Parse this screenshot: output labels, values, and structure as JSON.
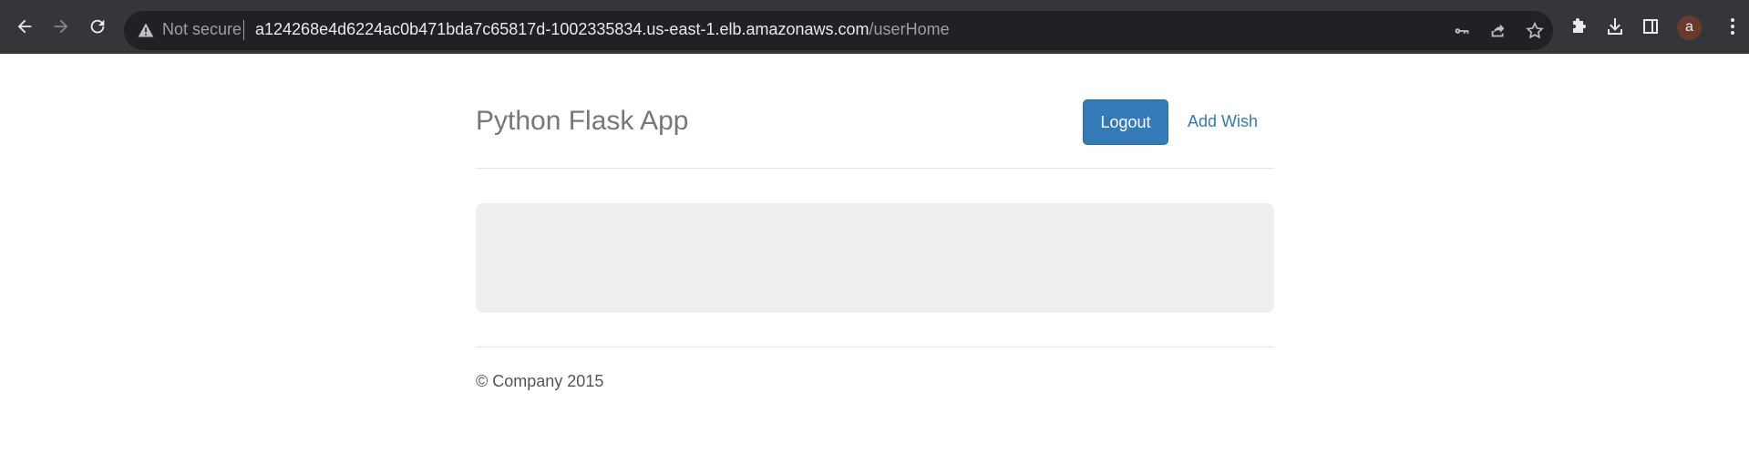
{
  "browser": {
    "security_label": "Not secure",
    "url_host": "a124268e4d6224ac0b471bda7c65817d-1002335834.us-east-1.elb.amazonaws.com",
    "url_path": "/userHome",
    "profile_initial": "a",
    "colors": {
      "toolbar": "#35363a",
      "omnibox": "#202124"
    }
  },
  "app": {
    "title": "Python Flask App",
    "nav": {
      "logout_label": "Logout",
      "add_wish_label": "Add Wish"
    },
    "footer": "© Company 2015",
    "colors": {
      "primary": "#337ab7",
      "jumbotron": "#eeeeee"
    }
  }
}
